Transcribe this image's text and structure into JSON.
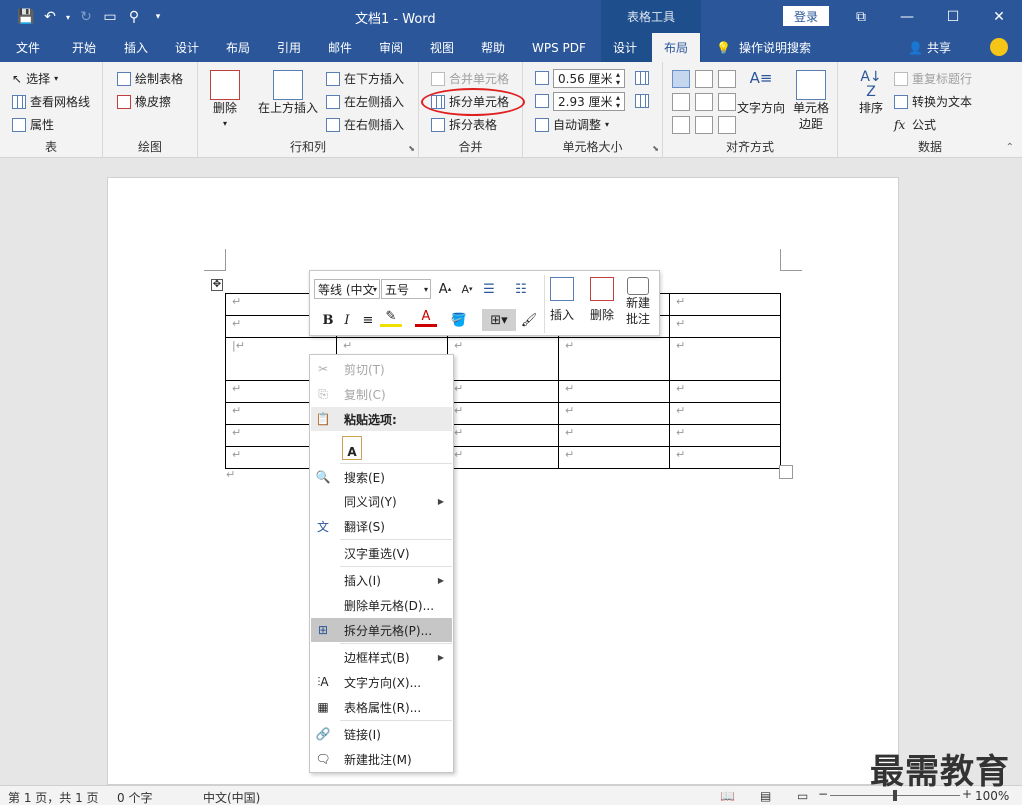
{
  "window": {
    "title": "文档1  -  Word",
    "tools_tab": "表格工具",
    "login": "登录"
  },
  "tabs": [
    "文件",
    "开始",
    "插入",
    "设计",
    "布局",
    "引用",
    "邮件",
    "审阅",
    "视图",
    "帮助",
    "WPS PDF",
    "设计",
    "布局"
  ],
  "active_tab_index": 12,
  "tell_me": "操作说明搜索",
  "share": "共享",
  "ribbon": {
    "table_group": {
      "label": "表",
      "items": [
        "选择",
        "查看网格线",
        "属性"
      ]
    },
    "draw_group": {
      "label": "绘图",
      "items": [
        "绘制表格",
        "橡皮擦"
      ]
    },
    "rows_cols_group": {
      "label": "行和列",
      "delete": "删除",
      "insert_above": "在上方插入",
      "insert_below": "在下方插入",
      "insert_left": "在左侧插入",
      "insert_right": "在右侧插入"
    },
    "merge_group": {
      "label": "合并",
      "merge_cells": "合并单元格",
      "split_cells": "拆分单元格",
      "split_table": "拆分表格"
    },
    "cell_size_group": {
      "label": "单元格大小",
      "height": "0.56 厘米",
      "width": "2.93 厘米",
      "autofit": "自动调整"
    },
    "alignment_group": {
      "label": "对齐方式",
      "text_direction": "文字方向",
      "cell_margins_1": "单元格",
      "cell_margins_2": "边距"
    },
    "data_group": {
      "label": "数据",
      "sort": "排序",
      "repeat_header": "重复标题行",
      "convert_to_text": "转换为文本",
      "formula": "公式"
    }
  },
  "mini_toolbar": {
    "font": "等线 (中文",
    "size": "五号",
    "bold": "B",
    "italic": "I",
    "insert": "插入",
    "delete": "删除",
    "new_comment_1": "新建",
    "new_comment_2": "批注"
  },
  "context_menu": {
    "cut": "剪切(T)",
    "copy": "复制(C)",
    "paste_options": "粘贴选项:",
    "search": "搜索(E)",
    "synonyms": "同义词(Y)",
    "translate": "翻译(S)",
    "reconvert": "汉字重选(V)",
    "insert": "插入(I)",
    "delete_cells": "删除单元格(D)...",
    "split_cells": "拆分单元格(P)...",
    "border_styles": "边框样式(B)",
    "text_direction": "文字方向(X)...",
    "table_properties": "表格属性(R)...",
    "link": "链接(I)",
    "new_comment": "新建批注(M)"
  },
  "status": {
    "page": "第 1 页，共 1 页",
    "words": "0 个字",
    "language": "中文(中国)",
    "zoom": "100%"
  },
  "watermark": "最需教育",
  "colors": {
    "brand": "#2b579a",
    "highlight": "#e02020"
  }
}
